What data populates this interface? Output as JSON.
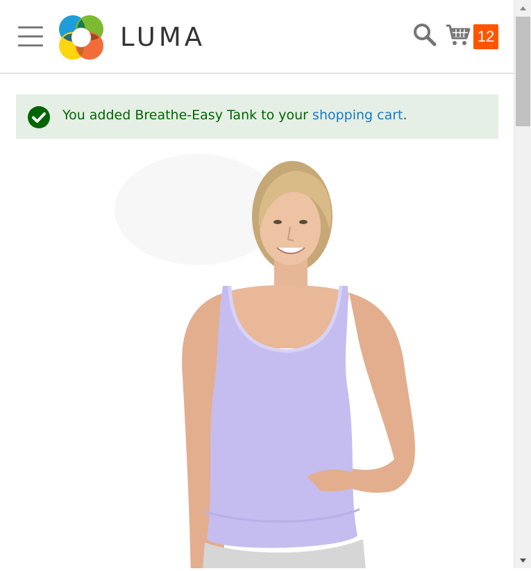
{
  "header": {
    "logo_text": "LUMA",
    "cart_count": "12"
  },
  "message": {
    "prefix": "You added Breathe-Easy Tank to your ",
    "link_text": "shopping cart",
    "suffix": "."
  },
  "product": {
    "image_alt": "Breathe-Easy Tank"
  },
  "icons": {
    "menu": "hamburger-icon",
    "search": "search-icon",
    "cart": "cart-icon",
    "success": "check-circle-icon",
    "scroll_up": "triangle-up-icon",
    "scroll_down": "triangle-down-icon"
  },
  "colors": {
    "accent_orange": "#ff5501",
    "message_bg": "#e5efe5",
    "message_text": "#006400",
    "link": "#1979c3",
    "tank": "#c5bdf0"
  }
}
